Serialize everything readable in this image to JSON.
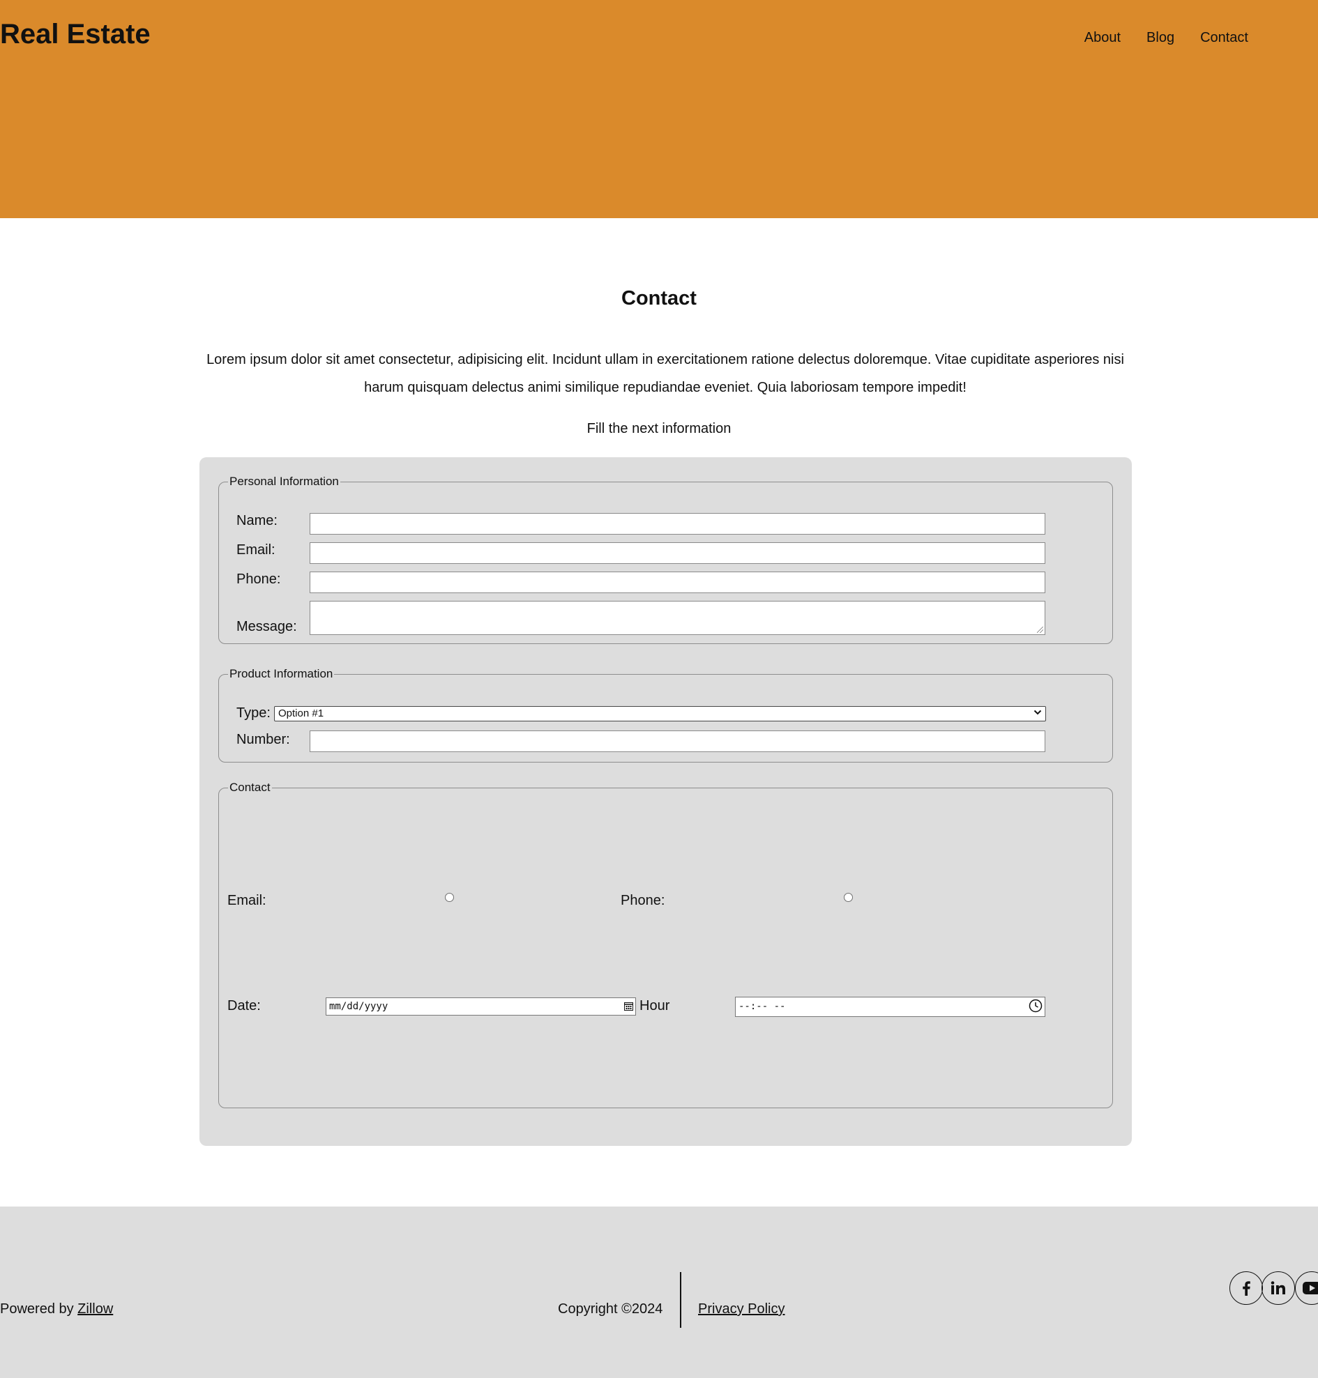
{
  "header": {
    "brand": "Real Estate",
    "nav": [
      "About",
      "Blog",
      "Contact"
    ],
    "background_color": "#da8a2b"
  },
  "main": {
    "title": "Contact",
    "intro": "Lorem ipsum dolor sit amet consectetur, adipisicing elit. Incidunt ullam in exercitationem ratione delectus doloremque. Vitae cupiditate asperiores nisi harum quisquam delectus animi similique repudiandae eveniet. Quia laboriosam tempore impedit!",
    "subtitle": "Fill the next information"
  },
  "form": {
    "personal": {
      "legend": "Personal Information",
      "name_label": "Name:",
      "name_value": "",
      "email_label": "Email:",
      "email_value": "",
      "phone_label": "Phone:",
      "phone_value": "",
      "message_label": "Message:",
      "message_value": ""
    },
    "product": {
      "legend": "Product Information",
      "type_label": "Type:",
      "type_selected": "Option #1",
      "number_label": "Number:",
      "number_value": ""
    },
    "contact": {
      "legend": "Contact",
      "email_label": "Email:",
      "phone_label": "Phone:",
      "date_label": "Date:",
      "date_placeholder": "mm/dd/yyyy",
      "hour_label": "Hour",
      "hour_placeholder": "--:-- --"
    }
  },
  "footer": {
    "powered_prefix": "Powered by ",
    "powered_link": "Zillow",
    "copyright": "Copyright ©2024",
    "privacy": "Privacy Policy",
    "social_icons": [
      "facebook-icon",
      "linkedin-icon",
      "youtube-icon"
    ]
  }
}
